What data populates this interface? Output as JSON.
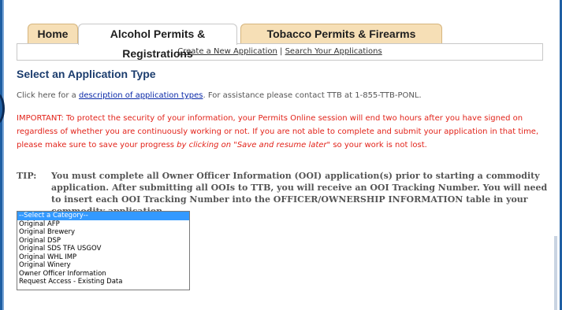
{
  "tabs": [
    {
      "label": "Home",
      "active": false
    },
    {
      "label": "Alcohol Permits & Registrations",
      "active": true
    },
    {
      "label": "Tobacco Permits & Firearms Registration",
      "active": false
    }
  ],
  "subnav": {
    "create_label": "Create a New Application",
    "separator": " | ",
    "search_label": "Search Your Applications"
  },
  "page_title": "Select an Application Type",
  "help": {
    "prefix": "Click here for a ",
    "link": "description of application types",
    "suffix": ".  For assistance please contact TTB at 1-855-TTB-PONL."
  },
  "important": {
    "text1": "IMPORTANT: To protect the security of your information, your Permits Online session will end two hours after you have signed on regardless of whether you are continuously working or not. If you are not able to complete and submit your application in that time, please make sure to save your progress ",
    "italic": "by clicking on \"Save and resume later\"",
    "text2": " so your work is not lost."
  },
  "tip": {
    "label": "TIP:",
    "text": "You must complete all Owner Officer Information (OOI) application(s) prior to starting a commodity application. After submitting all OOIs to TTB, you will receive an OOI Tracking Number.  You will need to insert each OOI Tracking Number into the OFFICER/OWNERSHIP INFORMATION table in your commodity application."
  },
  "category_list": {
    "options": [
      "--Select a Category--",
      "Original AFP",
      "Original Brewery",
      "Original DSP",
      "Original SDS TFA USGOV",
      "Original WHL IMP",
      "Original Winery",
      "Owner Officer Information",
      "Request Access - Existing Data"
    ],
    "selected_index": 0
  },
  "colors": {
    "accent": "#1c3d6e",
    "tab_bg": "#f6dfb6",
    "warning": "#e2231a",
    "link": "#0a29a8",
    "frame_bg": "#1f5fa3"
  }
}
